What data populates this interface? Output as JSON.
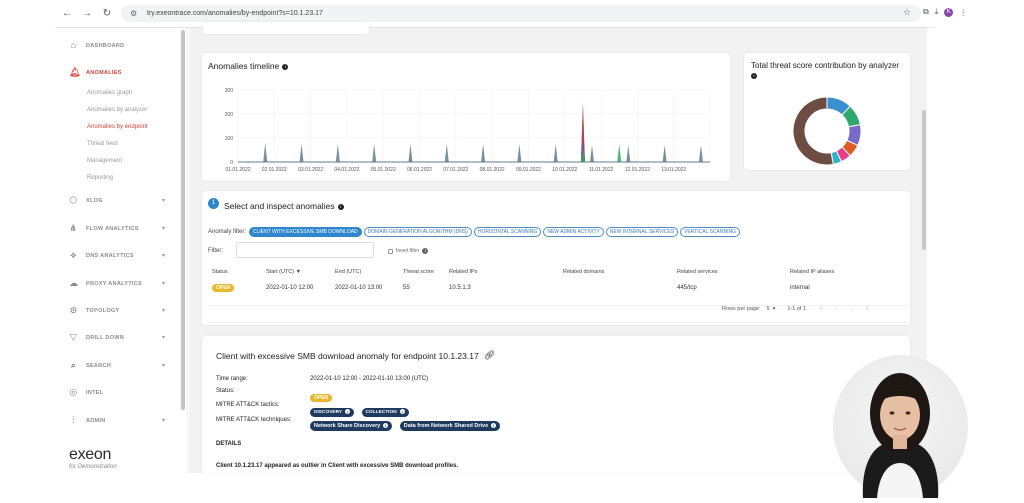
{
  "browser": {
    "url": "try.exeontrace.com/anomalies/by-endpoint?s=10.1.23.17",
    "avatar_letter": "K"
  },
  "sidebar": {
    "items": [
      {
        "label": "DASHBOARD",
        "icon": "home-icon"
      },
      {
        "label": "ANOMALIES",
        "icon": "bell-icon"
      },
      {
        "label": "XLOG",
        "icon": "cube-icon"
      },
      {
        "label": "FLOW ANALYTICS",
        "icon": "flow-icon"
      },
      {
        "label": "DNS ANALYTICS",
        "icon": "dns-icon"
      },
      {
        "label": "PROXY ANALYTICS",
        "icon": "cloud-icon"
      },
      {
        "label": "TOPOLOGY",
        "icon": "topology-icon"
      },
      {
        "label": "DRILL DOWN",
        "icon": "filter-icon"
      },
      {
        "label": "SEARCH",
        "icon": "search-icon"
      },
      {
        "label": "INTEL",
        "icon": "intel-icon"
      },
      {
        "label": "ADMIN",
        "icon": "sliders-icon"
      }
    ],
    "sub_items": [
      "Anomalies graph",
      "Anomalies by analyzer",
      "Anomalies by endpoint",
      "Threat feed",
      "Management",
      "Reporting"
    ],
    "logo": "exeon",
    "logo_sub": "for Demonstration"
  },
  "timeline": {
    "title": "Anomalies timeline",
    "chart_data": {
      "type": "line",
      "title": "Anomalies timeline",
      "yticks": [
        "0",
        "100",
        "200",
        "300"
      ],
      "ylim": [
        0,
        300
      ],
      "xticks": [
        "01.01.2022",
        "02.01.2022",
        "03.01.2022",
        "04.01.2022",
        "05.01.2022",
        "06.01.2022",
        "07.01.2022",
        "08.01.2022",
        "09.01.2022",
        "10.01.2022",
        "11.01.2022",
        "12.01.2022",
        "13.01.2022"
      ],
      "series": [
        {
          "color": "#607d8b",
          "points": [
            [
              0.75,
              80
            ],
            [
              1.75,
              75
            ],
            [
              2.75,
              75
            ],
            [
              3.75,
              75
            ],
            [
              4.75,
              75
            ],
            [
              5.75,
              75
            ],
            [
              6.75,
              75
            ],
            [
              7.75,
              75
            ],
            [
              8.75,
              75
            ],
            [
              9.5,
              250
            ],
            [
              9.75,
              70
            ],
            [
              10.75,
              70
            ],
            [
              11.75,
              70
            ],
            [
              12.75,
              70
            ],
            [
              13.75,
              70
            ]
          ]
        },
        {
          "color": "#c0392b",
          "points": [
            [
              9.5,
              240
            ]
          ]
        },
        {
          "color": "#8e44ad",
          "points": [
            [
              9.5,
              140
            ]
          ]
        },
        {
          "color": "#27ae60",
          "points": [
            [
              9.5,
              60
            ],
            [
              10.5,
              75
            ]
          ]
        }
      ]
    }
  },
  "threat_card": {
    "title": "Total threat score contribution by analyzer",
    "chart_data": {
      "type": "pie",
      "values": [
        12,
        10,
        10,
        6,
        5,
        4,
        53
      ],
      "colors": [
        "#3a8fd1",
        "#2fa86c",
        "#7a6ac7",
        "#e05a24",
        "#e83e8c",
        "#29b6c6",
        "#6d4c41"
      ]
    }
  },
  "anomalies": {
    "step": "1",
    "title": "Select and inspect anomalies",
    "filter_label": "Anomaly filter:",
    "filters": [
      "CLIENT WITH EXCESSIVE SMB DOWNLOAD",
      "DOMAIN GENERATION ALGORITHM (DNS)",
      "HORIZONTAL SCANNING",
      "NEW ADMIN ACTIVITY",
      "NEW INTERNAL SERVICES",
      "VERTICAL SCANNING"
    ],
    "filter_text_label": "Filter:",
    "invert_label": "Invert filter",
    "columns": [
      "Status",
      "Start (UTC) ▼",
      "End (UTC)",
      "Threat score",
      "Related IPs",
      "Related domains",
      "Related services",
      "Related IP aliases"
    ],
    "row": {
      "status": "OPEN",
      "start": "2022-01-10 12:00",
      "end": "2022-01-10 13:00",
      "score": "55",
      "ips": "10.5.1.3",
      "domains": "",
      "services": "445/tcp",
      "aliases": "internal"
    },
    "rows_per_page_label": "Rows per page:",
    "rows_per_page": "5",
    "range": "1-1 of 1"
  },
  "detail": {
    "title": "Client with excessive SMB download anomaly for endpoint 10.1.23.17",
    "time_range_label": "Time range:",
    "time_range": "2022-01-10 12:00 - 2022-01-10 13:00 (UTC)",
    "status_label": "Status:",
    "status": "OPEN",
    "tactics_label": "MITRE ATT&CK tactics:",
    "tactics": [
      "DISCOVERY",
      "COLLECTION"
    ],
    "techniques_label": "MITRE ATT&CK techniques:",
    "techniques": [
      "Network Share Discovery",
      "Data from Network Shared Drive"
    ],
    "details_heading": "DETAILS",
    "details_text": "Client 10.1.23.17 appeared as outlier in Client with excessive SMB download profiles."
  }
}
